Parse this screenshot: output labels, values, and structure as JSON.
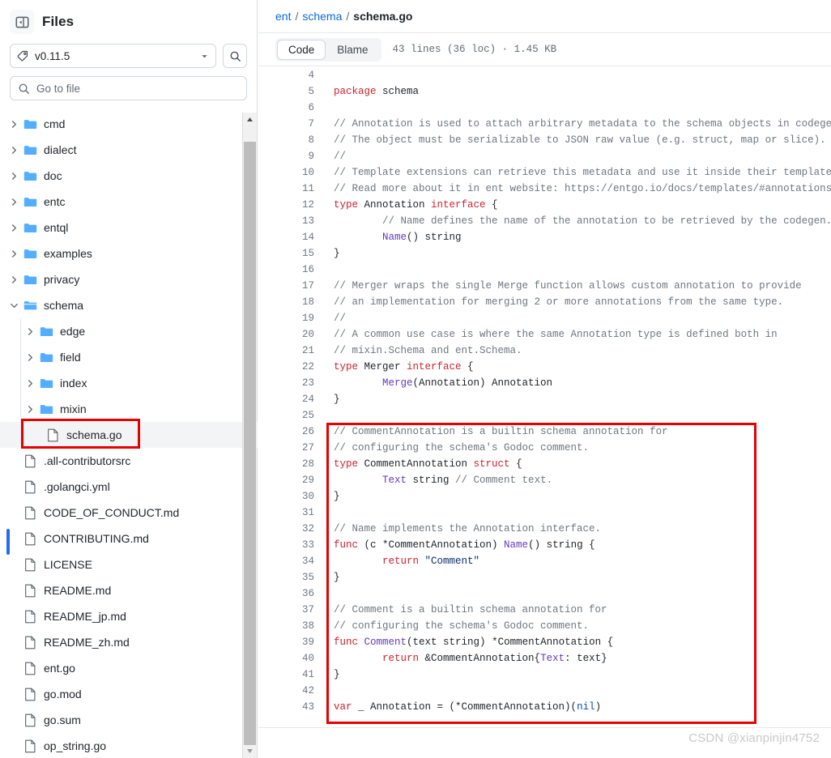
{
  "sidebar": {
    "toggle_icon": "sidebar-panel-icon",
    "title": "Files",
    "ref_selector": {
      "icon": "tag-icon",
      "value": "v0.11.5",
      "caret": "chevron-down-icon"
    },
    "search_button_icon": "search-icon",
    "go_to_file": {
      "icon": "search-icon",
      "placeholder": "Go to file",
      "value": ""
    },
    "tree": [
      {
        "label": "cmd",
        "type": "folder",
        "depth": 1,
        "expanded": false,
        "selected": false
      },
      {
        "label": "dialect",
        "type": "folder",
        "depth": 1,
        "expanded": false,
        "selected": false
      },
      {
        "label": "doc",
        "type": "folder",
        "depth": 1,
        "expanded": false,
        "selected": false
      },
      {
        "label": "entc",
        "type": "folder",
        "depth": 1,
        "expanded": false,
        "selected": false
      },
      {
        "label": "entql",
        "type": "folder",
        "depth": 1,
        "expanded": false,
        "selected": false
      },
      {
        "label": "examples",
        "type": "folder",
        "depth": 1,
        "expanded": false,
        "selected": false
      },
      {
        "label": "privacy",
        "type": "folder",
        "depth": 1,
        "expanded": false,
        "selected": false
      },
      {
        "label": "schema",
        "type": "folder",
        "depth": 1,
        "expanded": true,
        "selected": false
      },
      {
        "label": "edge",
        "type": "folder",
        "depth": 2,
        "expanded": false,
        "selected": false
      },
      {
        "label": "field",
        "type": "folder",
        "depth": 2,
        "expanded": false,
        "selected": false
      },
      {
        "label": "index",
        "type": "folder",
        "depth": 2,
        "expanded": false,
        "selected": false
      },
      {
        "label": "mixin",
        "type": "folder",
        "depth": 2,
        "expanded": false,
        "selected": false
      },
      {
        "label": "schema.go",
        "type": "file",
        "depth": 2,
        "expanded": false,
        "selected": true
      },
      {
        "label": ".all-contributorsrc",
        "type": "file",
        "depth": 1,
        "expanded": false,
        "selected": false
      },
      {
        "label": ".golangci.yml",
        "type": "file",
        "depth": 1,
        "expanded": false,
        "selected": false
      },
      {
        "label": "CODE_OF_CONDUCT.md",
        "type": "file",
        "depth": 1,
        "expanded": false,
        "selected": false
      },
      {
        "label": "CONTRIBUTING.md",
        "type": "file",
        "depth": 1,
        "expanded": false,
        "selected": false
      },
      {
        "label": "LICENSE",
        "type": "file",
        "depth": 1,
        "expanded": false,
        "selected": false
      },
      {
        "label": "README.md",
        "type": "file",
        "depth": 1,
        "expanded": false,
        "selected": false
      },
      {
        "label": "README_jp.md",
        "type": "file",
        "depth": 1,
        "expanded": false,
        "selected": false
      },
      {
        "label": "README_zh.md",
        "type": "file",
        "depth": 1,
        "expanded": false,
        "selected": false
      },
      {
        "label": "ent.go",
        "type": "file",
        "depth": 1,
        "expanded": false,
        "selected": false
      },
      {
        "label": "go.mod",
        "type": "file",
        "depth": 1,
        "expanded": false,
        "selected": false
      },
      {
        "label": "go.sum",
        "type": "file",
        "depth": 1,
        "expanded": false,
        "selected": false
      },
      {
        "label": "op_string.go",
        "type": "file",
        "depth": 1,
        "expanded": false,
        "selected": false
      }
    ]
  },
  "breadcrumb": {
    "parts": [
      "ent",
      "schema"
    ],
    "current": "schema.go",
    "separator": "/"
  },
  "toolbar": {
    "tabs": [
      {
        "label": "Code",
        "active": true
      },
      {
        "label": "Blame",
        "active": false
      }
    ],
    "meta": "43 lines (36 loc) · 1.45 KB"
  },
  "code": {
    "first_line": 4,
    "lines": [
      {
        "n": 4,
        "tokens": []
      },
      {
        "n": 5,
        "tokens": [
          {
            "t": "package ",
            "c": "k"
          },
          {
            "t": "schema",
            "c": ""
          }
        ]
      },
      {
        "n": 6,
        "tokens": []
      },
      {
        "n": 7,
        "tokens": [
          {
            "t": "// Annotation is used to attach arbitrary metadata to the schema objects in codegen.",
            "c": "cm"
          }
        ]
      },
      {
        "n": 8,
        "tokens": [
          {
            "t": "// The object must be serializable to JSON raw value (e.g. struct, map or slice).",
            "c": "cm"
          }
        ]
      },
      {
        "n": 9,
        "tokens": [
          {
            "t": "//",
            "c": "cm"
          }
        ]
      },
      {
        "n": 10,
        "tokens": [
          {
            "t": "// Template extensions can retrieve this metadata and use it inside their templates.",
            "c": "cm"
          }
        ]
      },
      {
        "n": 11,
        "tokens": [
          {
            "t": "// Read more about it in ent website: https://entgo.io/docs/templates/#annotations.",
            "c": "cm"
          }
        ]
      },
      {
        "n": 12,
        "tokens": [
          {
            "t": "type ",
            "c": "k"
          },
          {
            "t": "Annotation ",
            "c": ""
          },
          {
            "t": "interface",
            "c": "k"
          },
          {
            "t": " {",
            "c": ""
          }
        ]
      },
      {
        "n": 13,
        "tokens": [
          {
            "t": "        ",
            "c": ""
          },
          {
            "t": "// Name defines the name of the annotation to be retrieved by the codegen.",
            "c": "cm"
          }
        ]
      },
      {
        "n": 14,
        "tokens": [
          {
            "t": "        ",
            "c": ""
          },
          {
            "t": "Name",
            "c": "fn"
          },
          {
            "t": "() string",
            "c": ""
          }
        ]
      },
      {
        "n": 15,
        "tokens": [
          {
            "t": "}",
            "c": ""
          }
        ]
      },
      {
        "n": 16,
        "tokens": []
      },
      {
        "n": 17,
        "tokens": [
          {
            "t": "// Merger wraps the single Merge function allows custom annotation to provide",
            "c": "cm"
          }
        ]
      },
      {
        "n": 18,
        "tokens": [
          {
            "t": "// an implementation for merging 2 or more annotations from the same type.",
            "c": "cm"
          }
        ]
      },
      {
        "n": 19,
        "tokens": [
          {
            "t": "//",
            "c": "cm"
          }
        ]
      },
      {
        "n": 20,
        "tokens": [
          {
            "t": "// A common use case is where the same Annotation type is defined both in",
            "c": "cm"
          }
        ]
      },
      {
        "n": 21,
        "tokens": [
          {
            "t": "// mixin.Schema and ent.Schema.",
            "c": "cm"
          }
        ]
      },
      {
        "n": 22,
        "tokens": [
          {
            "t": "type ",
            "c": "k"
          },
          {
            "t": "Merger ",
            "c": ""
          },
          {
            "t": "interface",
            "c": "k"
          },
          {
            "t": " {",
            "c": ""
          }
        ]
      },
      {
        "n": 23,
        "tokens": [
          {
            "t": "        ",
            "c": ""
          },
          {
            "t": "Merge",
            "c": "fn"
          },
          {
            "t": "(Annotation) Annotation",
            "c": ""
          }
        ]
      },
      {
        "n": 24,
        "tokens": [
          {
            "t": "}",
            "c": ""
          }
        ]
      },
      {
        "n": 25,
        "tokens": []
      },
      {
        "n": 26,
        "tokens": [
          {
            "t": "// CommentAnnotation is a builtin schema annotation for",
            "c": "cm"
          }
        ]
      },
      {
        "n": 27,
        "tokens": [
          {
            "t": "// configuring the schema's Godoc comment.",
            "c": "cm"
          }
        ]
      },
      {
        "n": 28,
        "tokens": [
          {
            "t": "type ",
            "c": "k"
          },
          {
            "t": "CommentAnnotation ",
            "c": ""
          },
          {
            "t": "struct",
            "c": "k"
          },
          {
            "t": " {",
            "c": ""
          }
        ]
      },
      {
        "n": 29,
        "tokens": [
          {
            "t": "        ",
            "c": ""
          },
          {
            "t": "Text",
            "c": "fn"
          },
          {
            "t": " string ",
            "c": ""
          },
          {
            "t": "// Comment text.",
            "c": "cm"
          }
        ]
      },
      {
        "n": 30,
        "tokens": [
          {
            "t": "}",
            "c": ""
          }
        ]
      },
      {
        "n": 31,
        "tokens": []
      },
      {
        "n": 32,
        "tokens": [
          {
            "t": "// Name implements the Annotation interface.",
            "c": "cm"
          }
        ]
      },
      {
        "n": 33,
        "tokens": [
          {
            "t": "func",
            "c": "k"
          },
          {
            "t": " (c *CommentAnnotation) ",
            "c": ""
          },
          {
            "t": "Name",
            "c": "fn"
          },
          {
            "t": "() string {",
            "c": ""
          }
        ]
      },
      {
        "n": 34,
        "tokens": [
          {
            "t": "        ",
            "c": ""
          },
          {
            "t": "return ",
            "c": "k"
          },
          {
            "t": "\"Comment\"",
            "c": "st"
          }
        ]
      },
      {
        "n": 35,
        "tokens": [
          {
            "t": "}",
            "c": ""
          }
        ]
      },
      {
        "n": 36,
        "tokens": []
      },
      {
        "n": 37,
        "tokens": [
          {
            "t": "// Comment is a builtin schema annotation for",
            "c": "cm"
          }
        ]
      },
      {
        "n": 38,
        "tokens": [
          {
            "t": "// configuring the schema's Godoc comment.",
            "c": "cm"
          }
        ]
      },
      {
        "n": 39,
        "tokens": [
          {
            "t": "func",
            "c": "k"
          },
          {
            "t": " ",
            "c": ""
          },
          {
            "t": "Comment",
            "c": "fn"
          },
          {
            "t": "(text string) *CommentAnnotation {",
            "c": ""
          }
        ]
      },
      {
        "n": 40,
        "tokens": [
          {
            "t": "        ",
            "c": ""
          },
          {
            "t": "return ",
            "c": "k"
          },
          {
            "t": "&CommentAnnotation{",
            "c": ""
          },
          {
            "t": "Text",
            "c": "fn"
          },
          {
            "t": ": text}",
            "c": ""
          }
        ]
      },
      {
        "n": 41,
        "tokens": [
          {
            "t": "}",
            "c": ""
          }
        ]
      },
      {
        "n": 42,
        "tokens": []
      },
      {
        "n": 43,
        "tokens": [
          {
            "t": "var",
            "c": "k"
          },
          {
            "t": " _ Annotation = (*CommentAnnotation)(",
            "c": ""
          },
          {
            "t": "nil",
            "c": "cn"
          },
          {
            "t": ")",
            "c": ""
          }
        ]
      }
    ]
  },
  "annotations": {
    "box_color": "#e60000",
    "file_highlight_color": "#e60000",
    "active_marker_color": "#1f6feb"
  },
  "watermark": "CSDN @xianpinjin4752"
}
